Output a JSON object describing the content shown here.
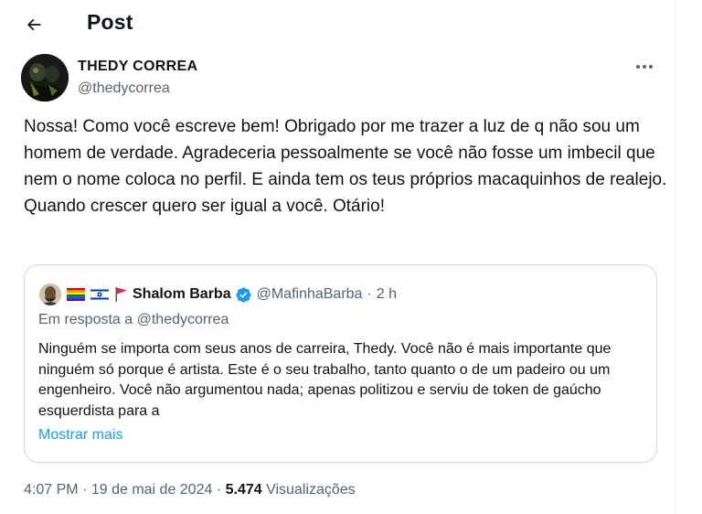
{
  "header": {
    "title": "Post"
  },
  "post": {
    "author_name": "THEDY CORREA",
    "author_handle": "@thedycorrea",
    "text": "Nossa! Como você escreve bem! Obrigado por me trazer a luz de q não sou um homem de verdade. Agradeceria pessoalmente se você não fosse um imbecil que nem o nome coloca no perfil. E ainda tem os teus próprios macaquinhos de realejo. Quando crescer quero ser igual a você. Otário!",
    "time": "4:07 PM",
    "date": "19 de mai de 2024",
    "views_count": "5.474",
    "views_label": "Visualizações"
  },
  "quote": {
    "name": "Shalom Barba",
    "handle": "@MafinhaBarba",
    "time": "2 h",
    "reply_to": "Em resposta a @thedycorrea",
    "text": "Ninguém se importa com seus anos de carreira, Thedy. Você não é mais importante que ninguém só porque é artista. Este é o seu trabalho, tanto quanto o de um padeiro ou um engenheiro. Você não argumentou nada; apenas politizou e serviu de token de gaúcho esquerdista para a",
    "show_more": "Mostrar mais"
  },
  "icons": {
    "back": "arrow-left-icon",
    "more": "more-horizontal-icon",
    "verified": "verified-badge-icon",
    "flags": [
      "rainbow-flag-icon",
      "israel-flag-icon",
      "red-flag-icon"
    ]
  },
  "colors": {
    "accent": "#1d9bf0",
    "secondary_text": "#536471",
    "primary_text": "#0f1419",
    "border": "#cfd9de"
  }
}
